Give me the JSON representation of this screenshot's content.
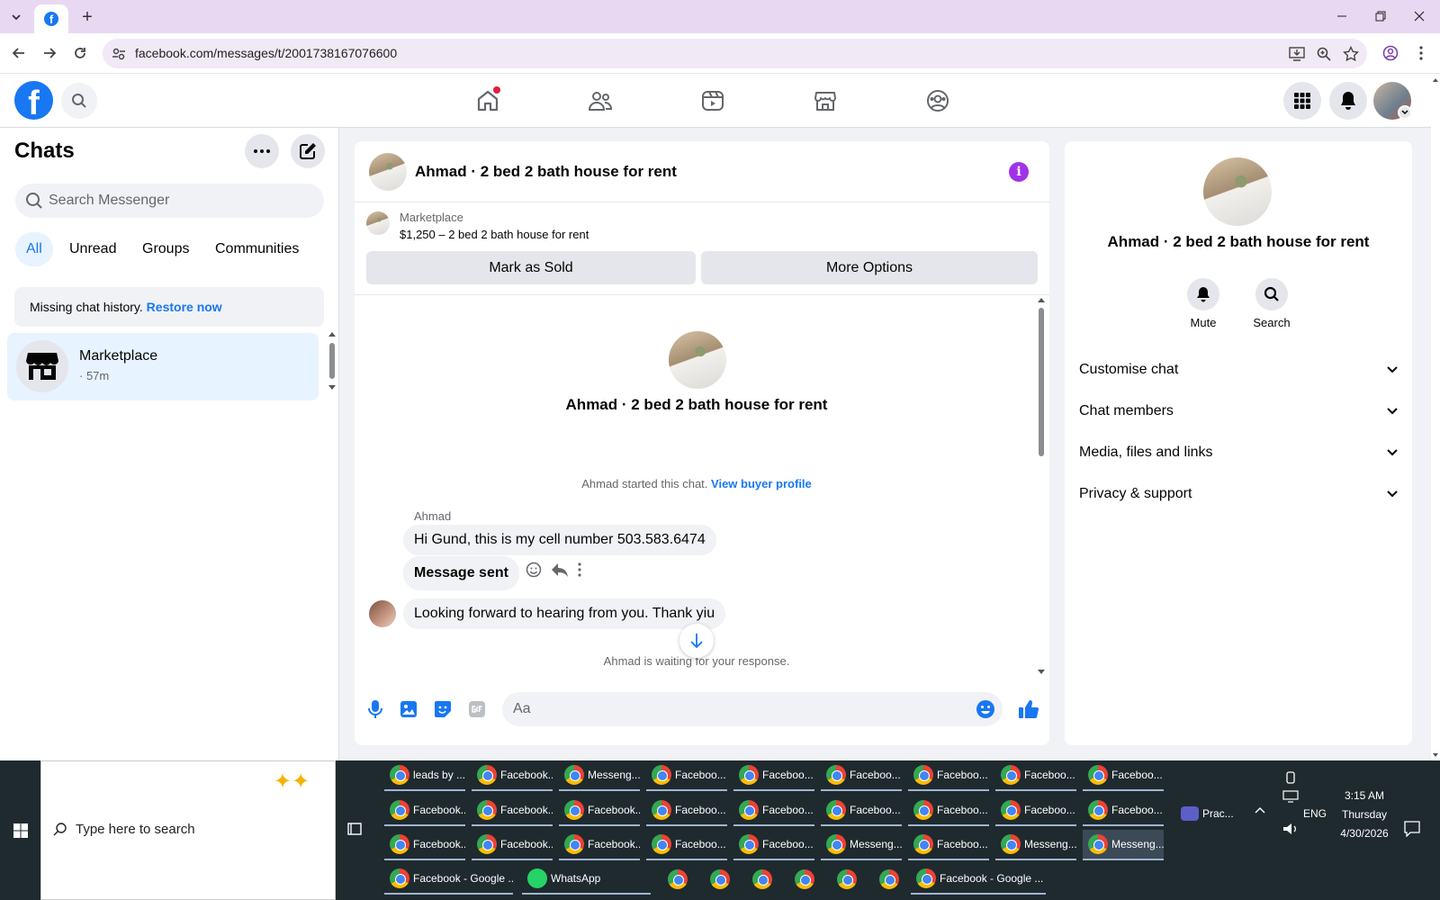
{
  "browser": {
    "url": "facebook.com/messages/t/2001738167076600",
    "favicon_letter": "f"
  },
  "fb": {
    "logo_letter": "f"
  },
  "sidebar": {
    "title": "Chats",
    "search_placeholder": "Search Messenger",
    "filters": [
      "All",
      "Unread",
      "Groups",
      "Communities"
    ],
    "active_filter": "All",
    "restore_text": "Missing chat history.",
    "restore_link": "Restore now",
    "chat": {
      "name": "Marketplace",
      "time": "· 57m"
    }
  },
  "conversation": {
    "title": "Ahmad · 2 bed 2 bath house for rent",
    "info_glyph": "i",
    "marketplace_label": "Marketplace",
    "listing": "$1,250 – 2 bed 2 bath house for rent",
    "mark_sold": "Mark as Sold",
    "more_options": "More Options",
    "intro_title": "Ahmad · 2 bed 2 bath house for rent",
    "started_text": "Ahmad started this chat.",
    "view_profile": "View buyer profile",
    "sender": "Ahmad",
    "messages": [
      "Hi Gund, this is my cell number 503.583.6474",
      "Message sent",
      "Looking forward to hearing from you. Thank yiu"
    ],
    "waiting": "Ahmad is waiting for your response.",
    "composer_placeholder": "Aa"
  },
  "info_panel": {
    "title": "Ahmad · 2 bed 2 bath house for rent",
    "mute": "Mute",
    "search": "Search",
    "sections": [
      "Customise chat",
      "Chat members",
      "Media, files and links",
      "Privacy & support"
    ]
  },
  "taskbar": {
    "search_placeholder": "Type here to search",
    "items_row1": [
      "leads by ...",
      "Facebook...",
      "Messeng...",
      "Faceboo...",
      "Faceboo...",
      "Faceboo...",
      "Faceboo...",
      "Faceboo...",
      "Faceboo..."
    ],
    "items_row2": [
      "Facebook...",
      "Facebook...",
      "Facebook...",
      "Faceboo...",
      "Faceboo...",
      "Faceboo...",
      "Faceboo...",
      "Faceboo...",
      "Faceboo..."
    ],
    "items_row3": [
      "Facebook...",
      "Facebook...",
      "Facebook...",
      "Faceboo...",
      "Faceboo...",
      "Messeng...",
      "Faceboo...",
      "Messeng...",
      "Messeng..."
    ],
    "row4_first": "Facebook - Google ...",
    "whatsapp": "WhatsApp",
    "row4_last": "Facebook - Google ...",
    "prac": "Prac...",
    "lang": "ENG",
    "time": "3:15 AM",
    "day": "Thursday",
    "date": "4/30/2026"
  },
  "colors": {
    "fb_blue": "#1877f2",
    "info_purple": "#a033e6",
    "tab_bar": "#e9d8f2",
    "taskbar": "#1f2a2e"
  },
  "icons": [
    "search-icon",
    "home-icon",
    "friends-icon",
    "video-icon",
    "marketplace-icon",
    "groups-icon",
    "menu-grid-icon",
    "bell-icon",
    "more-icon",
    "compose-icon",
    "mic-icon",
    "image-icon",
    "sticker-icon",
    "gif-icon",
    "emoji-icon",
    "like-icon",
    "chevron-down-icon",
    "arrow-down-icon"
  ]
}
